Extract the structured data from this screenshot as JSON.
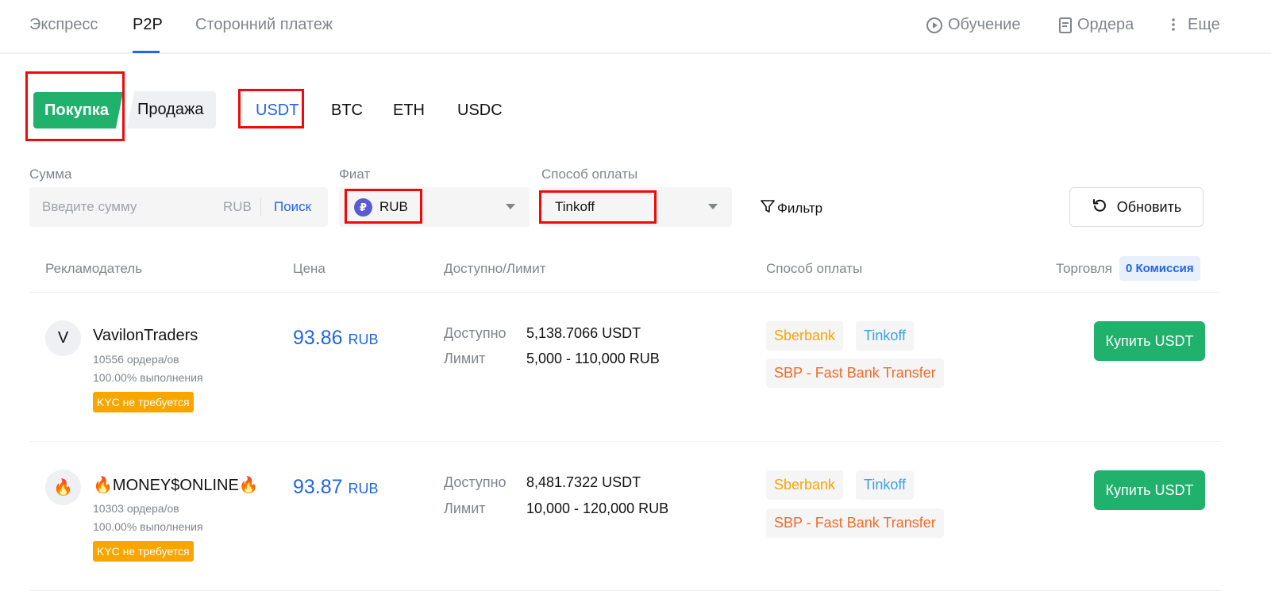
{
  "topnav": {
    "tabs": [
      "Экспресс",
      "P2P",
      "Сторонний платеж"
    ],
    "right": {
      "learn": "Обучение",
      "orders": "Ордера",
      "more": "Еще"
    }
  },
  "trade": {
    "buy": "Покупка",
    "sell": "Продажа"
  },
  "coins": [
    "USDT",
    "BTC",
    "ETH",
    "USDC"
  ],
  "filters": {
    "amount_label": "Сумма",
    "amount_placeholder": "Введите сумму",
    "amount_currency": "RUB",
    "search": "Поиск",
    "fiat_label": "Фиат",
    "fiat_value": "RUB",
    "fiat_symbol": "₽",
    "payment_label": "Способ оплаты",
    "payment_value": "Tinkoff",
    "filter": "Фильтр",
    "refresh": "Обновить"
  },
  "table": {
    "headers": {
      "advertiser": "Рекламодатель",
      "price": "Цена",
      "available": "Доступно/Лимит",
      "payment": "Способ оплаты",
      "trade": "Торговля",
      "commission": "0 Комиссия"
    },
    "rows": [
      {
        "avatar": "V",
        "name": "VavilonTraders",
        "orders": "10556 ордера/ов",
        "completion": "100.00% выполнения",
        "kyc": "KYC не требуется",
        "price": "93.86",
        "price_unit": "RUB",
        "available_label": "Доступно",
        "available": "5,138.7066 USDT",
        "limit_label": "Лимит",
        "limit": "5,000 - 110,000 RUB",
        "payments": [
          "Sberbank",
          "Tinkoff",
          "SBP - Fast Bank Transfer"
        ],
        "action": "Купить USDT"
      },
      {
        "avatar": "🔥",
        "name": "🔥MONEY$ONLINE🔥",
        "orders": "10303 ордера/ов",
        "completion": "100.00% выполнения",
        "kyc": "KYC не требуется",
        "price": "93.87",
        "price_unit": "RUB",
        "available_label": "Доступно",
        "available": "8,481.7322 USDT",
        "limit_label": "Лимит",
        "limit": "10,000 - 120,000 RUB",
        "payments": [
          "Sberbank",
          "Tinkoff",
          "SBP - Fast Bank Transfer"
        ],
        "action": "Купить USDT"
      }
    ]
  },
  "colors": {
    "accent": "#1f66e8",
    "buy": "#20b26c",
    "kyc": "#f7a600",
    "highlight": "#f20808"
  }
}
